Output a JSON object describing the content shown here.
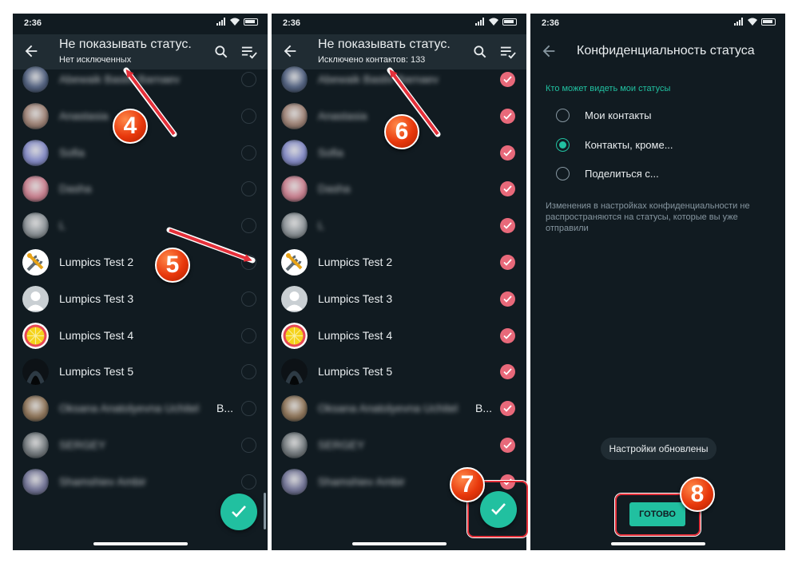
{
  "status_bar": {
    "time": "2:36"
  },
  "panel1": {
    "title": "Не показывать статус.",
    "subtitle": "Нет исключенных",
    "contacts": [
      {
        "name": "Abewaik Bastiv Barnaev",
        "blurred": true,
        "checked": false,
        "avatar": "#4a5a7a"
      },
      {
        "name": "Anastasia",
        "blurred": true,
        "checked": false,
        "avatar": "#9a7d70"
      },
      {
        "name": "Sofia",
        "blurred": true,
        "checked": false,
        "avatar": "#7f86c4"
      },
      {
        "name": "Dasha",
        "blurred": true,
        "checked": false,
        "avatar": "#c77a8a"
      },
      {
        "name": "L",
        "blurred": true,
        "checked": false,
        "avatar": "#888f94"
      },
      {
        "name": "Lumpics Test 2",
        "blurred": false,
        "checked": false,
        "avatar": "tools"
      },
      {
        "name": "Lumpics Test 3",
        "blurred": false,
        "checked": false,
        "avatar": "person"
      },
      {
        "name": "Lumpics Test 4",
        "blurred": false,
        "checked": false,
        "avatar": "lemon"
      },
      {
        "name": "Lumpics Test 5",
        "blurred": false,
        "checked": false,
        "avatar": "hood"
      },
      {
        "name": "Oksana Anatolyevna Uchitel",
        "blurred": true,
        "checked": false,
        "avatar": "#8a6f52",
        "suffix": "В..."
      },
      {
        "name": "SERGEY",
        "blurred": true,
        "checked": false,
        "avatar": "#6e7579"
      },
      {
        "name": "Shamshiev Ambir",
        "blurred": true,
        "checked": false,
        "avatar": "#6d6f93"
      }
    ]
  },
  "panel2": {
    "title": "Не показывать статус.",
    "subtitle": "Исключено контактов: 133",
    "all_checked": true
  },
  "panel3": {
    "title": "Конфиденциальность статуса",
    "section_label": "Кто может видеть мои статусы",
    "options": [
      {
        "label": "Мои контакты",
        "selected": false
      },
      {
        "label": "Контакты, кроме...",
        "selected": true
      },
      {
        "label": "Поделиться с...",
        "selected": false
      }
    ],
    "note": "Изменения в настройках конфиденциальности не распространяются на статусы, которые вы уже отправили",
    "toast": "Настройки обновлены",
    "done_button": "ГОТОВО"
  },
  "annotations": {
    "step4": "4",
    "step5": "5",
    "step6": "6",
    "step7": "7",
    "step8": "8"
  },
  "colors": {
    "background": "#111b21",
    "appbar": "#202c33",
    "accent": "#21c0a0",
    "check_on": "#e8697a",
    "annotation": "#e5303a"
  }
}
